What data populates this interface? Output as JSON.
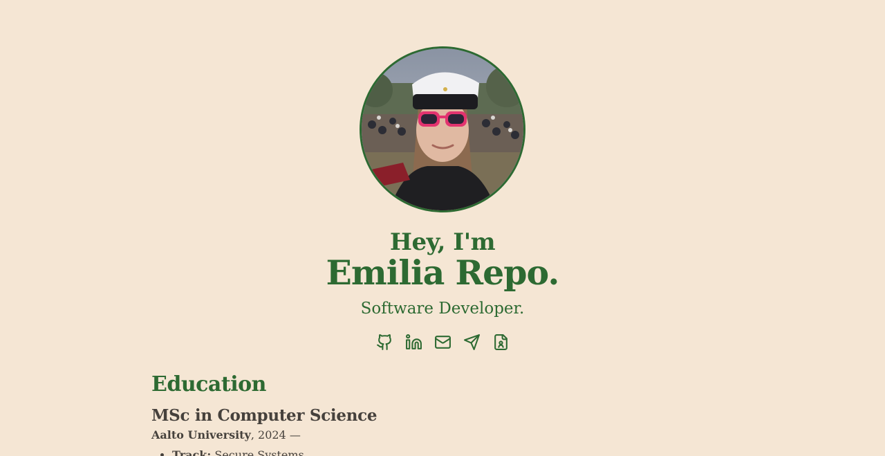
{
  "hero": {
    "greeting": "Hey, I'm",
    "name": "Emilia Repo.",
    "role": "Software Developer.",
    "avatar_alt": "Profile photo"
  },
  "socials": [
    {
      "icon": "github-icon",
      "label": "GitHub"
    },
    {
      "icon": "linkedin-icon",
      "label": "LinkedIn"
    },
    {
      "icon": "mail-icon",
      "label": "Email"
    },
    {
      "icon": "send-icon",
      "label": "Telegram"
    },
    {
      "icon": "resume-icon",
      "label": "CV"
    }
  ],
  "education": {
    "title": "Education",
    "items": [
      {
        "degree": "MSc in Computer Science",
        "university": "Aalto University",
        "period": ", 2024 —",
        "details": [
          {
            "label": "Track:",
            "value": "Secure Systems"
          }
        ]
      }
    ]
  },
  "colors": {
    "background": "#f5e6d4",
    "accent": "#2d6a32",
    "text": "#46413c"
  }
}
